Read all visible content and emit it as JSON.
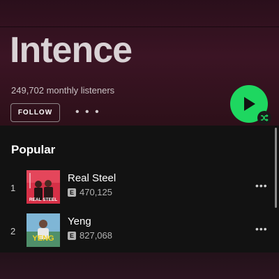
{
  "artist": {
    "name": "Intence",
    "monthly_listeners": "249,702 monthly listeners"
  },
  "actions": {
    "follow_label": "FOLLOW",
    "more_label": "• • •",
    "play_icon": "play-icon",
    "shuffle_icon": "shuffle-icon",
    "play_color": "#1ed760"
  },
  "popular": {
    "title": "Popular",
    "tracks": [
      {
        "number": "1",
        "title": "Real Steel",
        "explicit": "E",
        "plays": "470,125",
        "art_text": "REAL STEEL",
        "more": "•••"
      },
      {
        "number": "2",
        "title": "Yeng",
        "explicit": "E",
        "plays": "827,068",
        "art_text": "YENG",
        "more": "•••"
      }
    ]
  }
}
